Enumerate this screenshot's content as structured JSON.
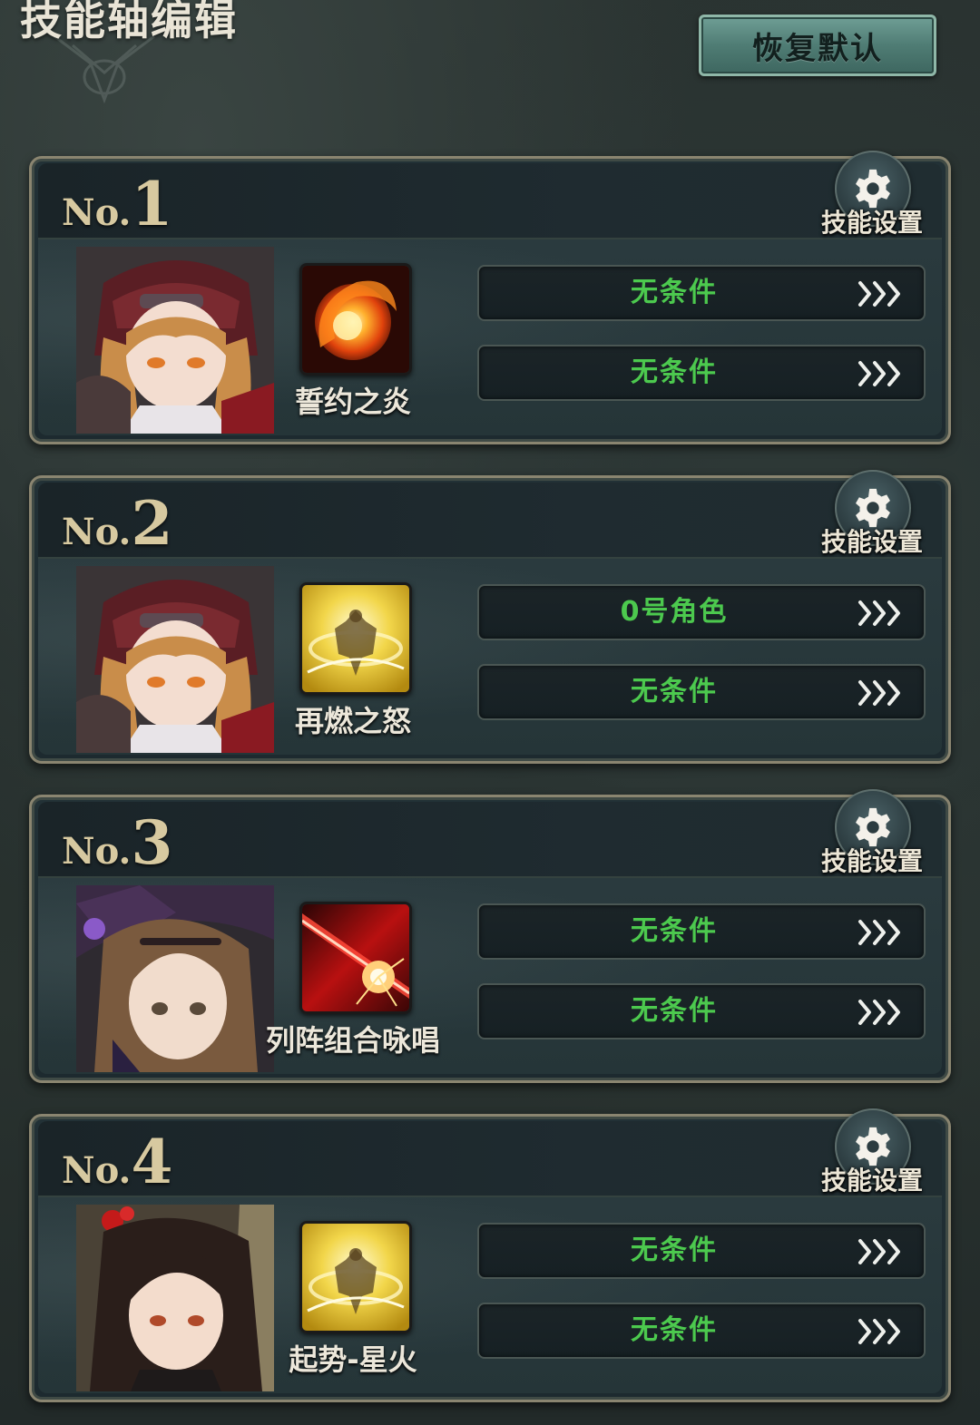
{
  "header": {
    "title": "技能轴编辑",
    "reset_label": "恢复默认"
  },
  "cards": [
    {
      "no_prefix": "No.",
      "number": "1",
      "settings_label": "技能设置",
      "skill_name": "誓约之炎",
      "skill_icon": "fireball-icon",
      "character": "hooded-girl-portrait",
      "conditions": [
        "无条件",
        "无条件"
      ]
    },
    {
      "no_prefix": "No.",
      "number": "2",
      "settings_label": "技能设置",
      "skill_name": "再燃之怒",
      "skill_icon": "golden-warrior-icon",
      "character": "hooded-girl-portrait",
      "conditions": [
        "0号角色",
        "无条件"
      ]
    },
    {
      "no_prefix": "No.",
      "number": "3",
      "settings_label": "技能设置",
      "skill_name": "列阵组合咏唱",
      "skill_icon": "red-beam-icon",
      "character": "witch-hat-girl-portrait",
      "conditions": [
        "无条件",
        "无条件"
      ]
    },
    {
      "no_prefix": "No.",
      "number": "4",
      "settings_label": "技能设置",
      "skill_name": "起势-星火",
      "skill_icon": "golden-warrior-icon",
      "character": "dark-hair-girl-portrait",
      "conditions": [
        "无条件",
        "无条件"
      ]
    }
  ],
  "colors": {
    "condition_text": "#4cc94e",
    "card_number": "#d7c9a0",
    "frame_gold": "#8a8570",
    "reset_button": "#5f8f86"
  }
}
